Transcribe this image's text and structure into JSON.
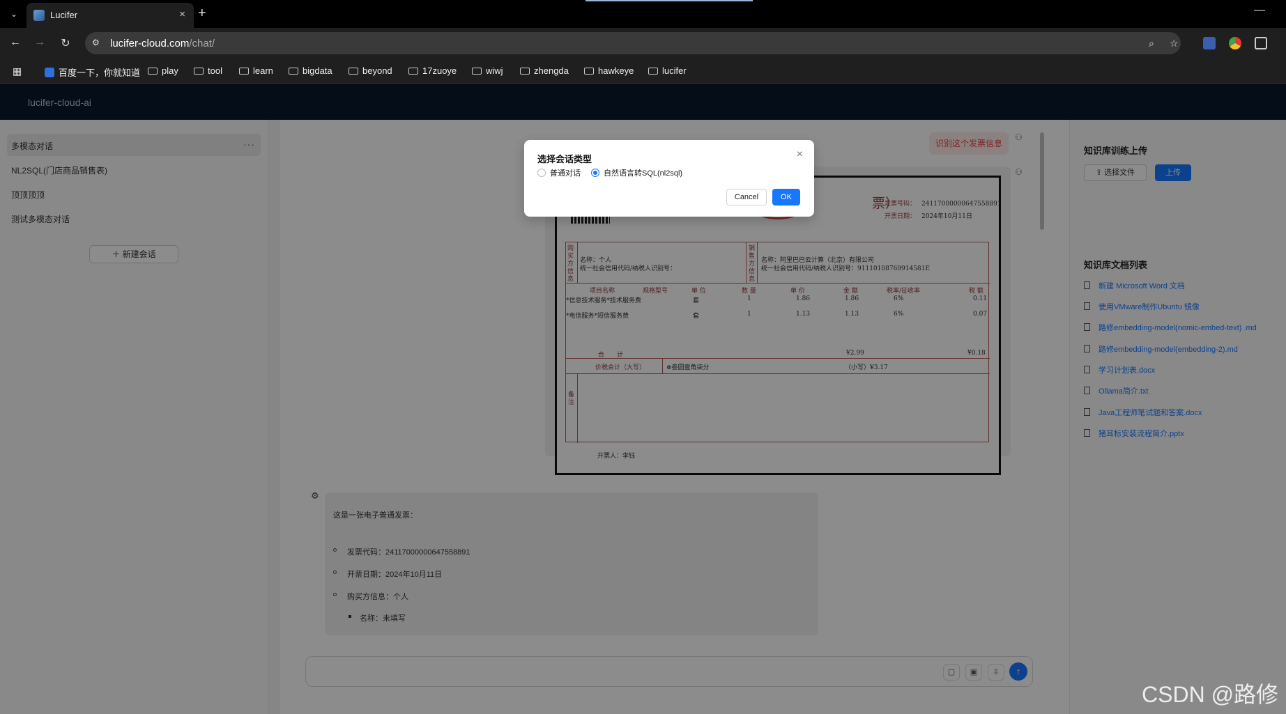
{
  "browser": {
    "tab_title": "Lucifer",
    "tab_close": "×",
    "new_tab": "+",
    "url_host": "lucifer-cloud.com",
    "url_path": "/chat/",
    "minimize": "—",
    "bookmarks": [
      {
        "label": "百度一下，你就知道",
        "icon": "baidu-icon"
      },
      {
        "label": "play",
        "icon": "folder-icon"
      },
      {
        "label": "tool",
        "icon": "folder-icon"
      },
      {
        "label": "learn",
        "icon": "folder-icon"
      },
      {
        "label": "bigdata",
        "icon": "folder-icon"
      },
      {
        "label": "beyond",
        "icon": "folder-icon"
      },
      {
        "label": "17zuoye",
        "icon": "folder-icon"
      },
      {
        "label": "wiwj",
        "icon": "folder-icon"
      },
      {
        "label": "zhengda",
        "icon": "folder-icon"
      },
      {
        "label": "hawkeye",
        "icon": "folder-icon"
      },
      {
        "label": "lucifer",
        "icon": "folder-icon"
      }
    ]
  },
  "app": {
    "brand": "lucifer-cloud-ai"
  },
  "sidebar": {
    "conversations": [
      {
        "label": "多模态对话",
        "active": true
      },
      {
        "label": "NL2SQL(门店商品销售表)",
        "active": false
      },
      {
        "label": "顶顶顶顶",
        "active": false
      },
      {
        "label": "测试多模态对话",
        "active": false
      }
    ],
    "more": "···",
    "new_conversation": "新建会话"
  },
  "chat": {
    "user_prompt": "识别这个发票信息",
    "invoice": {
      "title": "票）",
      "code_label": "发票号码：",
      "code": "24117000000647558891",
      "date_label": "开票日期：",
      "date": "2024年10月11日",
      "buyer_name": "名称：个人",
      "buyer_tax": "统一社会信用代码/纳税人识别号：",
      "seller_name": "名称：阿里巴巴云计算（北京）有限公司",
      "seller_tax": "统一社会信用代码/纳税人识别号：91110108769914581E",
      "buyer_side": "购买方信息",
      "seller_side": "销售方信息",
      "remark_side": "备注",
      "headers": [
        "项目名称",
        "规格型号",
        "单 位",
        "数 量",
        "单 价",
        "金 额",
        "税率/征收率",
        "税 额"
      ],
      "rows": [
        [
          "*信息技术服务*技术服务费",
          "套",
          "1",
          "1.86",
          "1.86",
          "6%",
          "0.11"
        ],
        [
          "*电信服务*短信服务费",
          "套",
          "1",
          "1.13",
          "1.13",
          "6%",
          "0.07"
        ]
      ],
      "total_label": "合　　计",
      "total_amount": "¥2.99",
      "total_tax": "¥0.18",
      "grand_label": "价税合计（大写）",
      "grand_text": "叁圆壹角柒分",
      "grand_small": "（小写）¥3.17",
      "issuer": "开票人：李钰"
    },
    "answer": {
      "intro": "这是一张电子普通发票：",
      "items": [
        "发票代码：24117000000647558891",
        "开票日期：2024年10月11日",
        "购买方信息：个人"
      ],
      "sub_items": [
        "名称：未填写"
      ]
    },
    "composer_tools": [
      "record-icon",
      "image-icon",
      "upload-icon"
    ],
    "send": "↑"
  },
  "right_panel": {
    "upload_title": "知识库训练上传",
    "select_file": "选择文件",
    "upload": "上传",
    "list_title": "知识库文档列表",
    "docs": [
      "新建 Microsoft Word 文档",
      "使用VMware制作Ubuntu 镜像",
      "路修embedding-model(nomic-embed-text) .md",
      "路修embedding-model(embedding-2).md",
      "学习计划表.docx",
      "Ollama简介.txt",
      "Java工程师笔试题和答案.docx",
      "猪耳标安装流程简介.pptx"
    ]
  },
  "modal": {
    "title": "选择会话类型",
    "close": "×",
    "options": [
      {
        "label": "普通对话",
        "selected": false
      },
      {
        "label": "自然语言转SQL(nl2sql)",
        "selected": true
      }
    ],
    "cancel": "Cancel",
    "ok": "OK"
  },
  "watermark": "CSDN @路修"
}
